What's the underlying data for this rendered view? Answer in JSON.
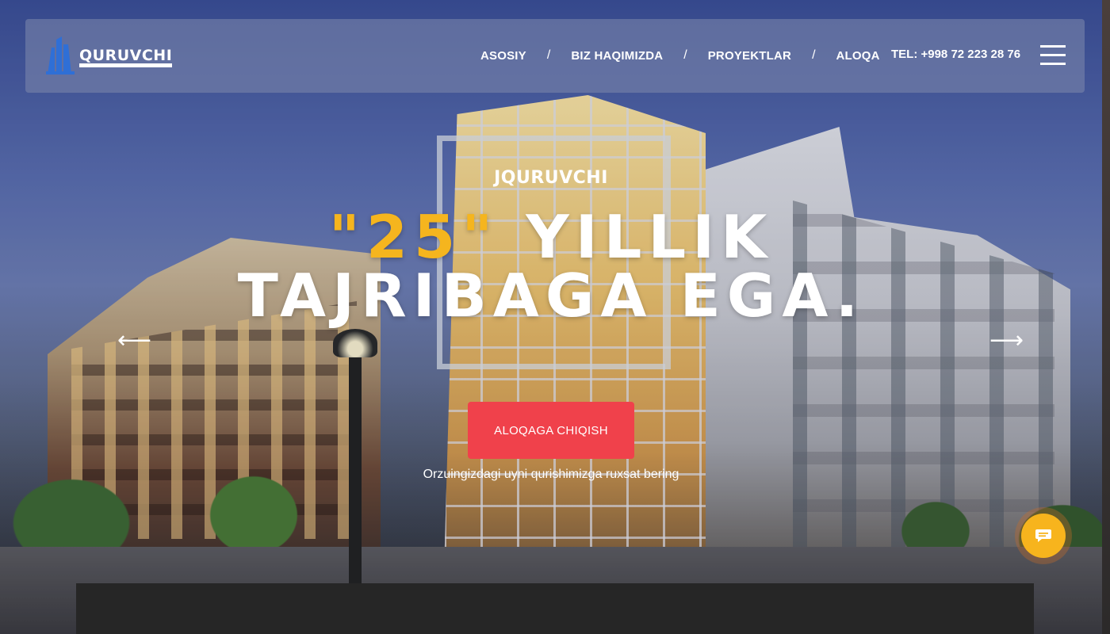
{
  "brand": {
    "logo_text": "QURUVCHI"
  },
  "nav": {
    "items": [
      "ASOSIY",
      "BIZ HAQIMIZDA",
      "PROYEKTLAR",
      "ALOQA"
    ],
    "separator": "/",
    "phone": "TEL: +998 72 223 28 76"
  },
  "hero": {
    "kicker": "JQURUVCHI",
    "headline_quote_open": "\"",
    "headline_number": "25",
    "headline_quote_close": "\"",
    "headline_line1_rest": " YILLIK",
    "headline_line2": "TAJRIBAGA EGA.",
    "prev_arrow": "⟵",
    "next_arrow": "⟶",
    "cta_label": "ALOQAGA CHIQISH",
    "subtitle": "Orzuingizdagi uyni qurishimizga ruxsat bering"
  },
  "colors": {
    "accent": "#f5b51e",
    "cta": "#f0414b",
    "chat": "#f7b41d",
    "panel": "#262626"
  },
  "icons": {
    "menu": "hamburger-menu-icon",
    "chat": "chat-icon",
    "logo": "building-logo-icon"
  }
}
